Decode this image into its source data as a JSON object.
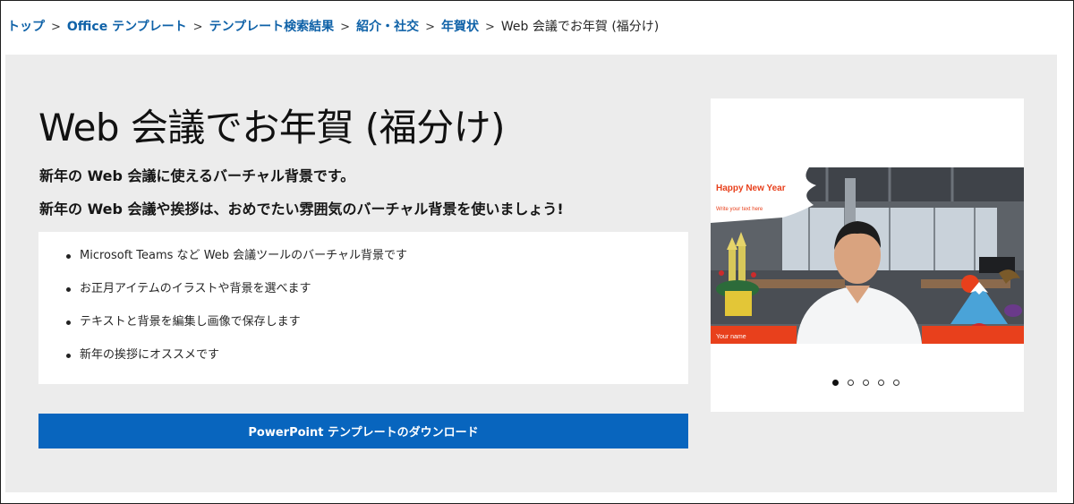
{
  "breadcrumb": {
    "items": [
      "トップ",
      "Office テンプレート",
      "テンプレート検索結果",
      "紹介・社交",
      "年賀状"
    ],
    "separator": ">",
    "current": "Web 会議でお年賀 (福分け)"
  },
  "hero": {
    "title": "Web 会議でお年賀 (福分け)",
    "subtitle_1": "新年の Web 会議に使えるバーチャル背景です。",
    "subtitle_2": "新年の Web 会議や挨拶は、おめでたい雰囲気のバーチャル背景を使いましょう!",
    "features": [
      "Microsoft Teams など Web 会議ツールのバーチャル背景です",
      "お正月アイテムのイラストや背景を選べます",
      "テキストと背景を編集し画像で保存します",
      "新年の挨拶にオススメです"
    ],
    "download_label": "PowerPoint テンプレートのダウンロード"
  },
  "preview": {
    "slide_title": "Happy New Year",
    "slide_subtitle": "Write your text here",
    "slide_name": "Your name",
    "dot_count": 5,
    "active_dot": 0
  },
  "colors": {
    "link": "#0f62a8",
    "button": "#0865be",
    "accent_red": "#e8401c",
    "hero_bg": "#ececec"
  }
}
